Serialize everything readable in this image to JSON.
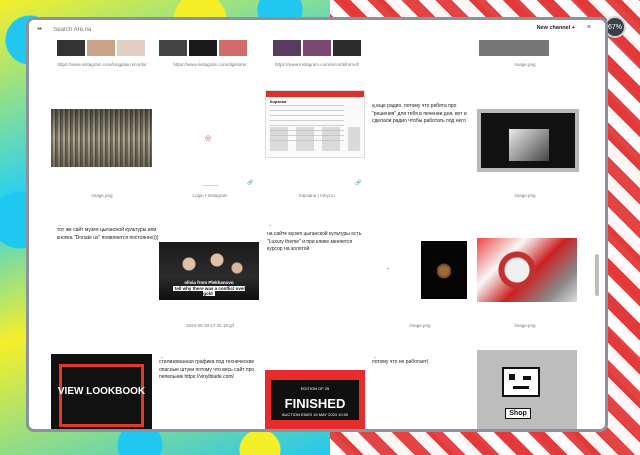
{
  "toolbar": {
    "logo": "**",
    "search_placeholder": "Search Are.na",
    "new_channel": "New channel +",
    "close": "×"
  },
  "counter": "67%",
  "row1": {
    "captions": [
      "https://www.instagram.com/longplay.records/",
      "https://www.instagram.com/digistore/",
      "https://www.instagram.com/recordsfromuf/",
      "image.png"
    ]
  },
  "row2": {
    "caption_1": "image.png",
    "caption_2": "Login • Instagram",
    "caption_2_small": "———",
    "caption_3": "Корзина | Vinyl.ru",
    "caption_5": "image.png",
    "note_text": "а еще радио, потому что ребята про \"решения\" для тебя в печении дня, вот и сделали радио чтобы работать под него",
    "site_title": "Корзина"
  },
  "row3": {
    "note_1": "тот же сайт музея цыганской культуры или кнопка \"Donate us\" появляется постоянно)))",
    "caption_2": "2024-05-30 17.32.19.gif",
    "video_text_top": "olivia from Plekhanovo",
    "video_text_bottom": "tell why there was a conflict over gold",
    "note_3": "на сайте музея цыганской культуры есть \"Luxury theme\" и при клике меняется курсор на золотой",
    "caption_4": "image.png",
    "caption_5": "image.png"
  },
  "row4": {
    "lookbook": "VIEW LOOKBOOK",
    "note_2": "стилизованная графика под технические опасные штуки потому что весь сайт про пепельник https://vinylblade.com/",
    "finished_small": "EDITION OF 25",
    "finished_big": "FINISHED",
    "finished_small2": "AUCTION ENDS 15 MAY 2024 10:00",
    "note_4": "потому что не работает)",
    "shop_label": "Shop"
  },
  "arrow": "→"
}
